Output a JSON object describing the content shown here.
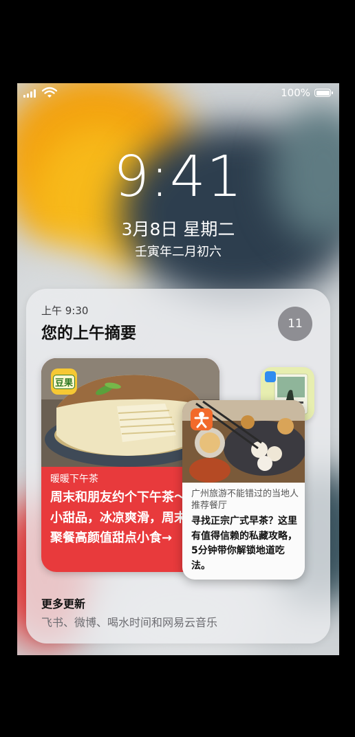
{
  "status_bar": {
    "battery_percent_text": "100%",
    "battery_level": 1.0,
    "icons": [
      "cellular-signal-icon",
      "wifi-icon",
      "battery-icon"
    ]
  },
  "lock_screen": {
    "time": "9:41",
    "date": "3月8日 星期二",
    "lunar_date": "壬寅年二月初六"
  },
  "summary": {
    "time_label": "上午 9:30",
    "title": "您的上午摘要",
    "count": "11",
    "cards": [
      {
        "app": "豆果",
        "app_icon": "douguo-app-icon",
        "tag": "暖暖下午茶",
        "text": "周末和朋友约个下午茶～自制小甜品，冰凉爽滑，周末闺蜜聚餐高颜值甜点小食→",
        "accent": "#e83a3c"
      },
      {
        "app_icon": "travel-app-icon",
        "tag": "广州旅游不能错过的当地人推荐餐厅",
        "text": "寻找正宗广式早茶？这里有值得信赖的私藏攻略，5分钟带你解锁地道吃法。"
      },
      {
        "app_icon": "book-cover-icon"
      }
    ],
    "more_updates_title": "更多更新",
    "more_updates_text": "飞书、微博、喝水时间和网易云音乐"
  }
}
